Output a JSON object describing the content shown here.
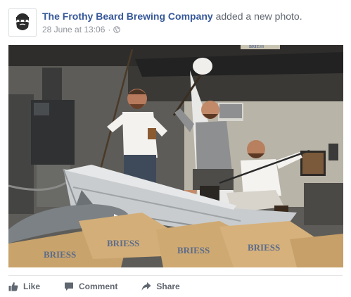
{
  "post": {
    "author": "The Frothy Beard Brewing Company",
    "action": "added a new photo.",
    "timestamp": "28 June at 13:06",
    "separator": "·",
    "privacy_icon": "globe-icon",
    "avatar_icon": "bearded-face-logo-icon"
  },
  "photo": {
    "sacks_label": "BRIESS",
    "sign_label": "BRIESS"
  },
  "actions": {
    "like_label": "Like",
    "comment_label": "Comment",
    "share_label": "Share"
  },
  "colors": {
    "link": "#365899",
    "secondary": "#90949c",
    "action": "#616770"
  }
}
